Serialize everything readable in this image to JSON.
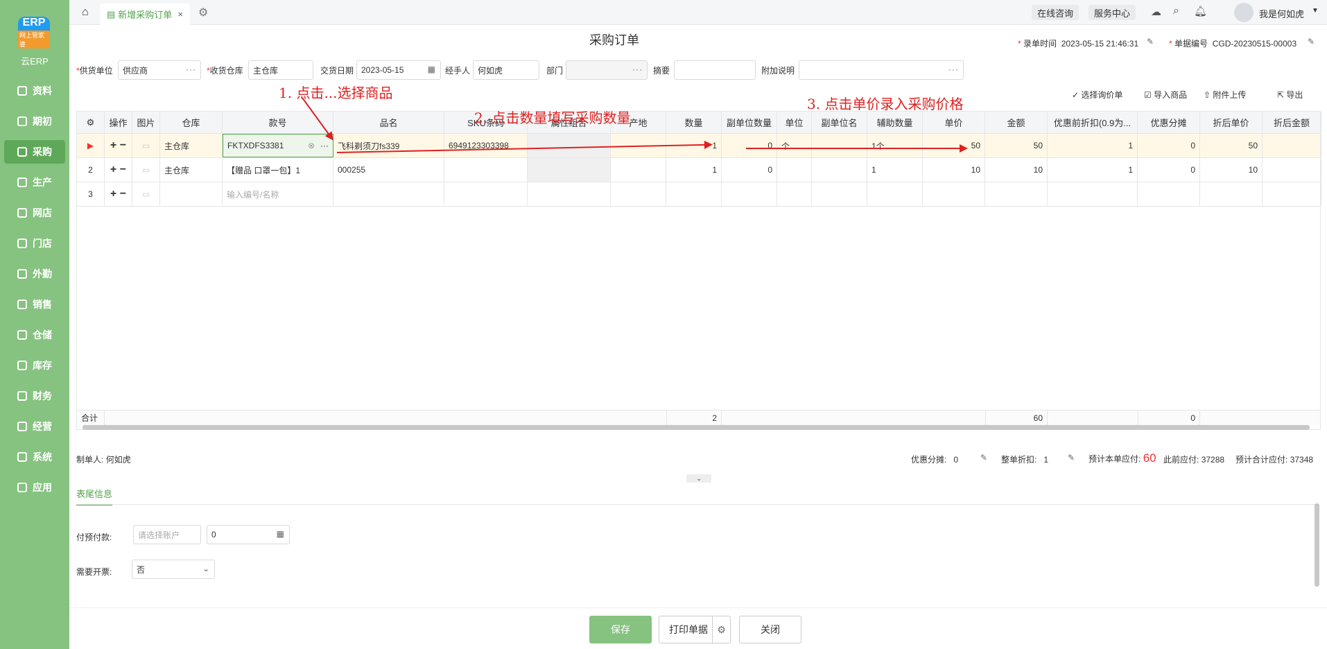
{
  "sidebar": {
    "logo_mark": "ERP",
    "logo_badge": "网上管家婆",
    "logo_name": "云ERP",
    "items": [
      "资料",
      "期初",
      "采购",
      "生产",
      "网店",
      "门店",
      "外勤",
      "销售",
      "仓储",
      "库存",
      "财务",
      "经营",
      "系统",
      "应用"
    ]
  },
  "topbar": {
    "tab_title": "新增采购订单",
    "close": "×",
    "online": "在线咨询",
    "service": "服务中心",
    "user": "我是何如虎"
  },
  "header": {
    "title": "采购订单",
    "entry_time_label": "录单时间",
    "entry_time": "2023-05-15 21:46:31",
    "doc_no_label": "单据编号",
    "doc_no": "CGD-20230515-00003"
  },
  "form": {
    "supplier_label": "供货单位",
    "supplier": "供应商",
    "warehouse_label": "收货仓库",
    "warehouse": "主仓库",
    "date_label": "交货日期",
    "date": "2023-05-15",
    "handler_label": "经手人",
    "handler": "何如虎",
    "dept_label": "部门",
    "dept": "",
    "summary_label": "摘要",
    "summary": "",
    "note_label": "附加说明",
    "note": ""
  },
  "toolbar": {
    "choose_quote": "选择询价单",
    "import_goods": "导入商品",
    "attach": "附件上传",
    "export": "导出"
  },
  "grid": {
    "headers": [
      "操作",
      "图片",
      "仓库",
      "款号",
      "品名",
      "SKU条码",
      "属性组合",
      "产地",
      "数量",
      "副单位数量",
      "单位",
      "副单位名",
      "辅助数量",
      "单价",
      "金额",
      "优惠前折扣(0.9为...",
      "优惠分摊",
      "折后单价",
      "折后金额"
    ],
    "rows": [
      {
        "no": "",
        "wh": "主仓库",
        "code": "FKTXDFS3381",
        "name": "飞科剃须刀fs339",
        "sku": "6949123303398",
        "qty": "1",
        "subqty": "0",
        "unit": "个",
        "aux": "1个",
        "price": "50",
        "amount": "50",
        "disc": "1",
        "share": "0",
        "dprice": "50"
      },
      {
        "no": "2",
        "wh": "主仓库",
        "code": "【赠品 口罩一包】1",
        "name": "000255",
        "sku": "",
        "qty": "1",
        "subqty": "0",
        "unit": "",
        "aux": "1",
        "price": "10",
        "amount": "10",
        "disc": "1",
        "share": "0",
        "dprice": "10"
      },
      {
        "no": "3",
        "wh": "",
        "code": "",
        "name": "",
        "sku": "",
        "qty": "",
        "subqty": "",
        "unit": "",
        "aux": "",
        "price": "",
        "amount": "",
        "disc": "",
        "share": "",
        "dprice": ""
      }
    ],
    "row3_placeholder": "输入编号/名称",
    "total_label": "合计",
    "total_qty": "2",
    "total_amount": "60",
    "total_share": "0"
  },
  "annotations": {
    "step1": "1. 点击...选择商品",
    "step2": "2. 点击数量填写采购数量",
    "step3": "3. 点击单价录入采购价格"
  },
  "footer": {
    "maker_label": "制单人:",
    "maker": "何如虎",
    "share_label": "优惠分摊:",
    "share": "0",
    "discount_label": "整单折扣:",
    "discount": "1",
    "due_label": "预计本单应付:",
    "due": "60",
    "prev_label": "此前应付:",
    "prev": "37288",
    "total_label": "预计合计应付:",
    "total": "37348"
  },
  "tail": {
    "section": "表尾信息",
    "prepay_label": "付预付款:",
    "account_placeholder": "请选择账户",
    "prepay_amount": "0",
    "invoice_label": "需要开票:",
    "invoice": "否"
  },
  "actions": {
    "save": "保存",
    "print": "打印单据",
    "close": "关闭"
  },
  "colors": {
    "brand": "#86c280",
    "accent": "#52a34b",
    "annotation": "#e02020"
  }
}
